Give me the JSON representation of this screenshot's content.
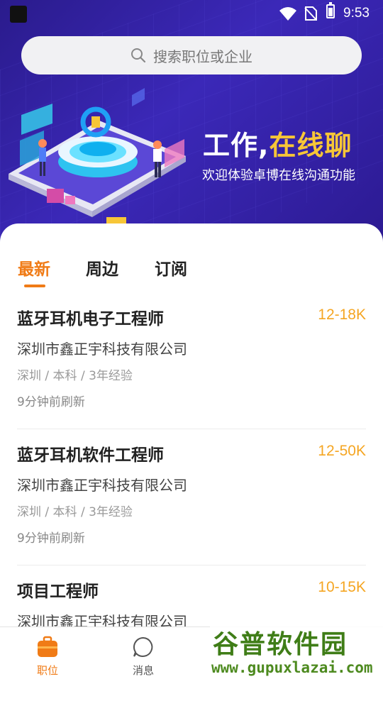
{
  "status_bar": {
    "time": "9:53"
  },
  "search": {
    "placeholder": "搜索职位或企业",
    "icon": "search-icon"
  },
  "banner": {
    "title_part1": "工作,",
    "title_part2": "在线聊",
    "subtitle": "欢迎体验卓博在线沟通功能",
    "accent_color": "#f7c637"
  },
  "tabs": [
    {
      "label": "最新",
      "active": true
    },
    {
      "label": "周边",
      "active": false
    },
    {
      "label": "订阅",
      "active": false
    }
  ],
  "jobs": [
    {
      "title": "蓝牙耳机电子工程师",
      "salary": "12-18K",
      "company": "深圳市鑫正宇科技有限公司",
      "meta": "深圳 / 本科 / 3年经验",
      "updated": "9分钟前刷新"
    },
    {
      "title": "蓝牙耳机软件工程师",
      "salary": "12-50K",
      "company": "深圳市鑫正宇科技有限公司",
      "meta": "深圳 / 本科 / 3年经验",
      "updated": "9分钟前刷新"
    },
    {
      "title": "项目工程师",
      "salary": "10-15K",
      "company": "深圳市鑫正宇科技有限公司"
    }
  ],
  "bottom_nav": [
    {
      "label": "职位",
      "icon": "briefcase-icon",
      "active": true
    },
    {
      "label": "消息",
      "icon": "chat-bubble-icon",
      "active": false
    }
  ],
  "watermark": {
    "main": "谷普软件园",
    "url": "www.gupuxlazai.com"
  },
  "colors": {
    "primary": "#f07b16",
    "salary": "#f5a623",
    "hero_bg": "#3b28b8"
  }
}
